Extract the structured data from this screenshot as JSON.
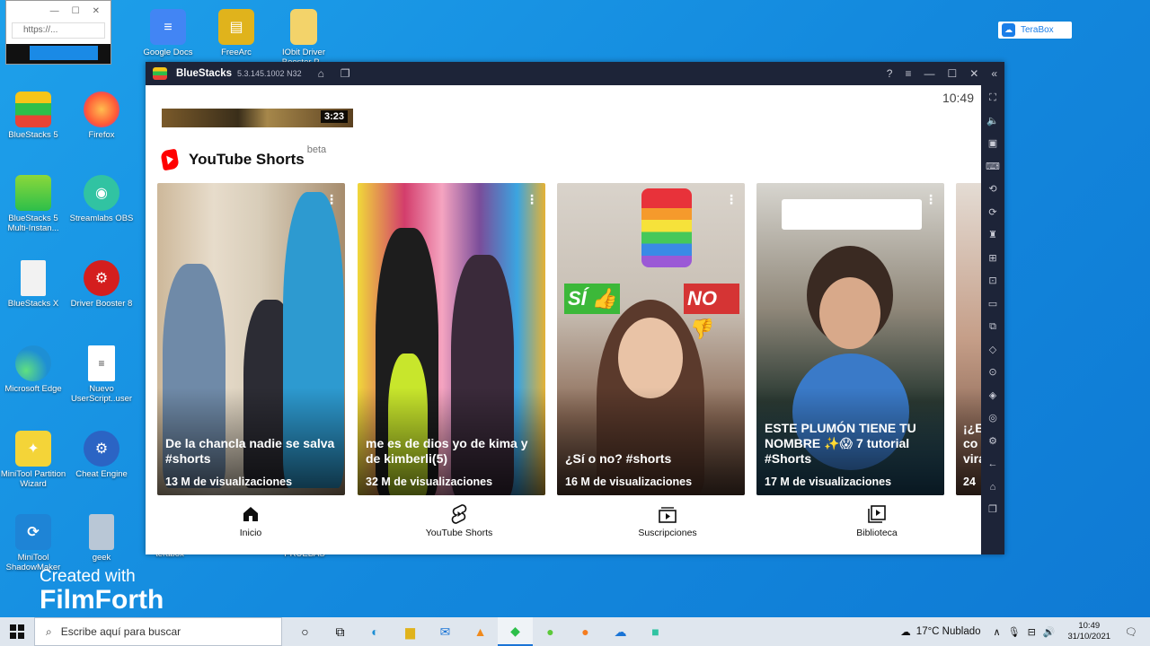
{
  "desktop": {
    "icons": [
      {
        "label": "Google Docs"
      },
      {
        "label": "FreeArc"
      },
      {
        "label": "IObit Driver Booster P..."
      },
      {
        "label": "BlueStacks 5"
      },
      {
        "label": "Firefox"
      },
      {
        "label": "BlueStacks 5 Multi-Instan..."
      },
      {
        "label": "Streamlabs OBS"
      },
      {
        "label": "BlueStacks X"
      },
      {
        "label": "Driver Booster 8"
      },
      {
        "label": "Microsoft Edge"
      },
      {
        "label": "Nuevo UserScript..user"
      },
      {
        "label": "MiniTool Partition Wizard"
      },
      {
        "label": "Cheat Engine"
      },
      {
        "label": "MiniTool ShadowMaker"
      },
      {
        "label": "geek"
      }
    ],
    "mini_browser_url": "https://...",
    "terabox_label": "TeraBox",
    "watermark_line1": "Created with",
    "watermark_line2": "FilmForth",
    "hidden_labels": [
      "terabox",
      "PRUEBAS"
    ]
  },
  "bluestacks": {
    "title": "BlueStacks",
    "version": "5.3.145.1002 N32",
    "clock": "10:49"
  },
  "youtube": {
    "previous_duration": "3:23",
    "shorts_title": "YouTube Shorts",
    "shorts_badge": "beta",
    "shorts": [
      {
        "title": "De la chancla nadie se salva #shorts",
        "views": "13 M de visualizaciones"
      },
      {
        "title": "me es de dios yo de kima y de kimberli(5)",
        "views": "32 M de visualizaciones"
      },
      {
        "title": "¿Sí o no? #shorts",
        "views": "16 M de visualizaciones"
      },
      {
        "title": "ESTE PLUMÓN TIENE TU NOMBRE ✨😱 7 tutorial #Shorts",
        "views": "17 M de visualizaciones"
      },
      {
        "title": "¡¿E co vira",
        "views": "24"
      }
    ],
    "stickers": {
      "yes": "SÍ",
      "no": "NO"
    },
    "nav": [
      {
        "label": "Inicio"
      },
      {
        "label": "YouTube Shorts"
      },
      {
        "label": "Suscripciones"
      },
      {
        "label": "Biblioteca"
      }
    ]
  },
  "taskbar": {
    "search_placeholder": "Escribe aquí para buscar",
    "weather": "17°C  Nublado",
    "time": "10:49",
    "date": "31/10/2021"
  }
}
